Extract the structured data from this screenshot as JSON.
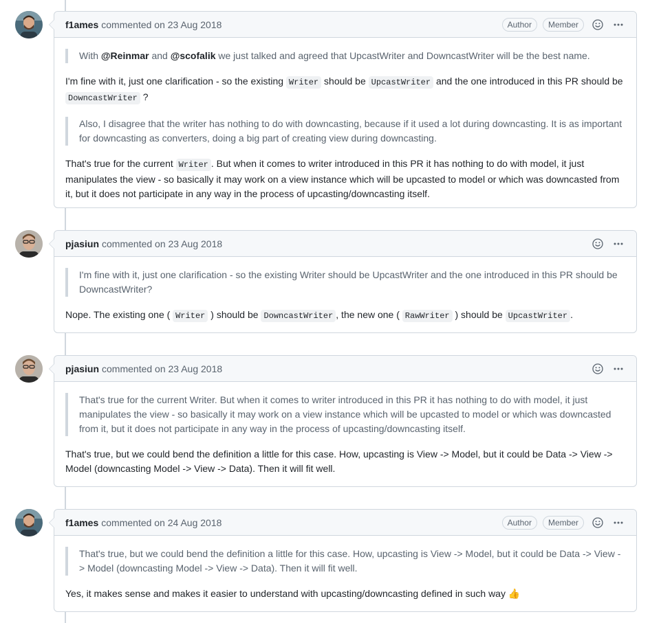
{
  "comments": [
    {
      "author": "f1ames",
      "meta": "commented on 23 Aug 2018",
      "badges": [
        "Author",
        "Member"
      ],
      "quote1": {
        "prefix": "With ",
        "mention1": "@Reinmar",
        "mid": " and ",
        "mention2": "@scofalik",
        "suffix": " we just talked and agreed that UpcastWriter and DowncastWriter will be the best name."
      },
      "p1": {
        "t1": "I'm fine with it, just one clarification - so the existing ",
        "c1": "Writer",
        "t2": " should be ",
        "c2": "UpcastWriter",
        "t3": " and the one introduced in this PR should be ",
        "c3": "DowncastWriter",
        "t4": " ?"
      },
      "quote2": "Also, I disagree that the writer has nothing to do with downcasting, because if it used a lot during downcasting. It is as important for downcasting as converters, doing a big part of creating view during downcasting.",
      "p2": {
        "t1": "That's true for the current ",
        "c1": "Writer",
        "t2": ". But when it comes to writer introduced in this PR it has nothing to do with model, it just manipulates the view - so basically it may work on a view instance which will be upcasted to model or which was downcasted from it, but it does not participate in any way in the process of upcasting/downcasting itself."
      }
    },
    {
      "author": "pjasiun",
      "meta": "commented on 23 Aug 2018",
      "quote": "I'm fine with it, just one clarification - so the existing Writer should be UpcastWriter and the one introduced in this PR should be DowncastWriter?",
      "p": {
        "t1": "Nope. The existing one ( ",
        "c1": "Writer",
        "t2": " ) should be ",
        "c2": "DowncastWriter",
        "t3": ", the new one ( ",
        "c3": "RawWriter",
        "t4": " ) should be ",
        "c4": "UpcastWriter",
        "t5": "."
      }
    },
    {
      "author": "pjasiun",
      "meta": "commented on 23 Aug 2018",
      "quote": "That's true for the current Writer. But when it comes to writer introduced in this PR it has nothing to do with model, it just manipulates the view - so basically it may work on a view instance which will be upcasted to model or which was downcasted from it, but it does not participate in any way in the process of upcasting/downcasting itself.",
      "p": "That's true, but we could bend the definition a little for this case. How, upcasting is View -> Model, but it could be Data -> View -> Model (downcasting Model -> View -> Data). Then it will fit well."
    },
    {
      "author": "f1ames",
      "meta": "commented on 24 Aug 2018",
      "badges": [
        "Author",
        "Member"
      ],
      "quote": "That's true, but we could bend the definition a little for this case. How, upcasting is View -> Model, but it could be Data -> View -> Model (downcasting Model -> View -> Data). Then it will fit well.",
      "p": "Yes, it makes sense and makes it easier to understand with upcasting/downcasting defined in such way",
      "emoji": "👍"
    }
  ],
  "icons": {
    "reaction": "smiley-icon",
    "menu": "kebab-horizontal-icon"
  }
}
